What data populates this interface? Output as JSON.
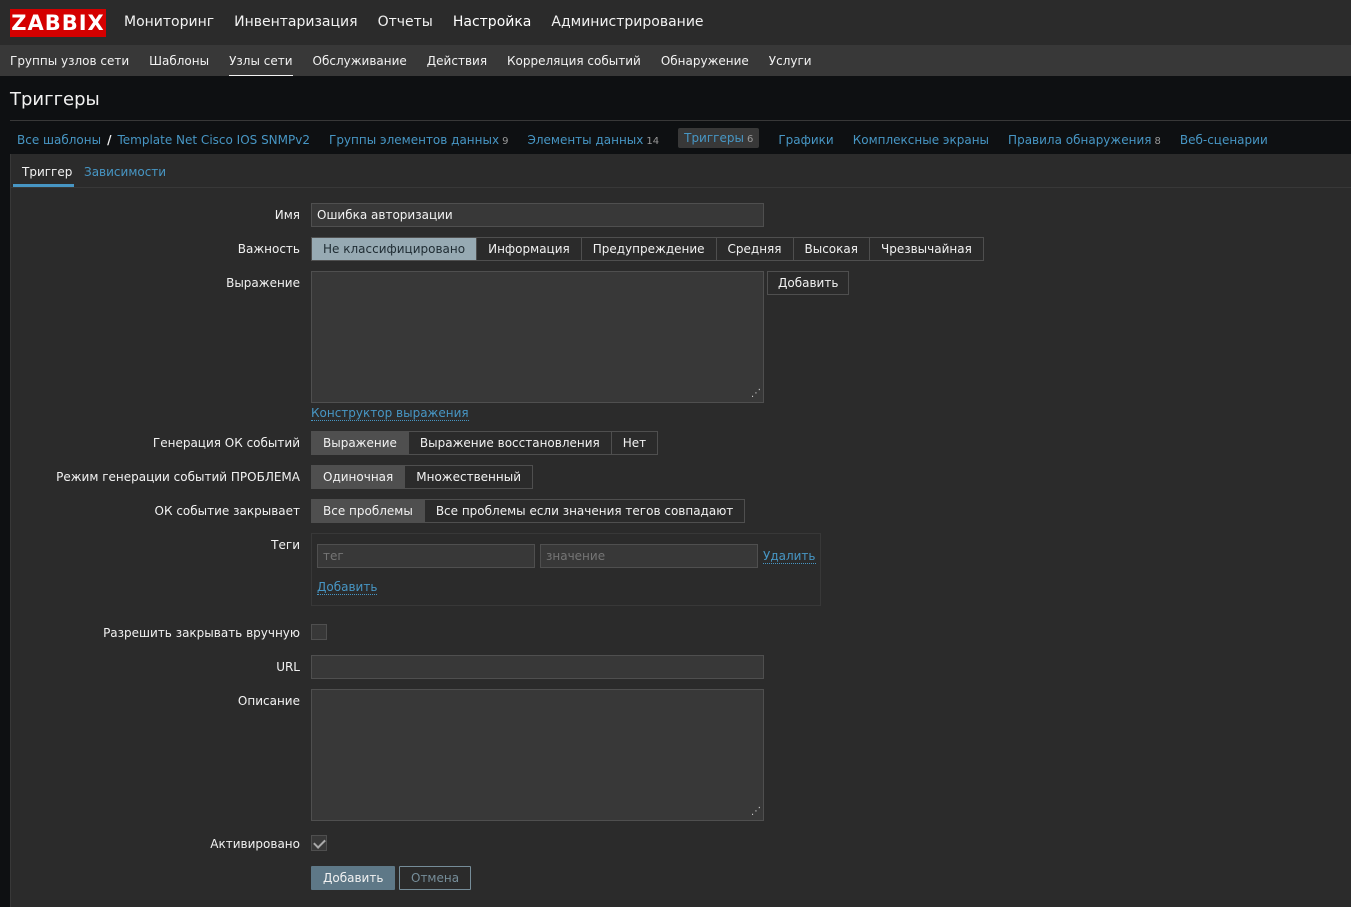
{
  "logo": "ZABBIX",
  "topmenu": [
    "Мониторинг",
    "Инвентаризация",
    "Отчеты",
    "Настройка",
    "Администрирование"
  ],
  "submenu": [
    "Группы узлов сети",
    "Шаблоны",
    "Узлы сети",
    "Обслуживание",
    "Действия",
    "Корреляция событий",
    "Обнаружение",
    "Услуги"
  ],
  "page_title": "Триггеры",
  "breadcrumb": {
    "all_templates": "Все шаблоны",
    "template": "Template Net Cisco IOS SNMPv2",
    "tabs": [
      {
        "label": "Группы элементов данных",
        "count": "9"
      },
      {
        "label": "Элементы данных",
        "count": "14"
      },
      {
        "label": "Триггеры",
        "count": "6"
      },
      {
        "label": "Графики",
        "count": ""
      },
      {
        "label": "Комплексные экраны",
        "count": ""
      },
      {
        "label": "Правила обнаружения",
        "count": "8"
      },
      {
        "label": "Веб-сценарии",
        "count": ""
      }
    ]
  },
  "form_tabs": [
    "Триггер",
    "Зависимости"
  ],
  "form": {
    "name_label": "Имя",
    "name_value": "Ошибка авторизации",
    "severity_label": "Важность",
    "severity_options": [
      "Не классифицировано",
      "Информация",
      "Предупреждение",
      "Средняя",
      "Высокая",
      "Чрезвычайная"
    ],
    "expression_label": "Выражение",
    "add_expr_button": "Добавить",
    "expr_constructor": "Конструктор выражения",
    "ok_gen_label": "Генерация ОК событий",
    "ok_gen_options": [
      "Выражение",
      "Выражение восстановления",
      "Нет"
    ],
    "problem_mode_label": "Режим генерации событий ПРОБЛЕМА",
    "problem_mode_options": [
      "Одиночная",
      "Множественный"
    ],
    "ok_closes_label": "ОК событие закрывает",
    "ok_closes_options": [
      "Все проблемы",
      "Все проблемы если значения тегов совпадают"
    ],
    "tags_label": "Теги",
    "tag_placeholder": "тег",
    "value_placeholder": "значение",
    "tag_remove": "Удалить",
    "tag_add": "Добавить",
    "manual_close_label": "Разрешить закрывать вручную",
    "url_label": "URL",
    "description_label": "Описание",
    "enabled_label": "Активировано",
    "submit": "Добавить",
    "cancel": "Отмена"
  }
}
